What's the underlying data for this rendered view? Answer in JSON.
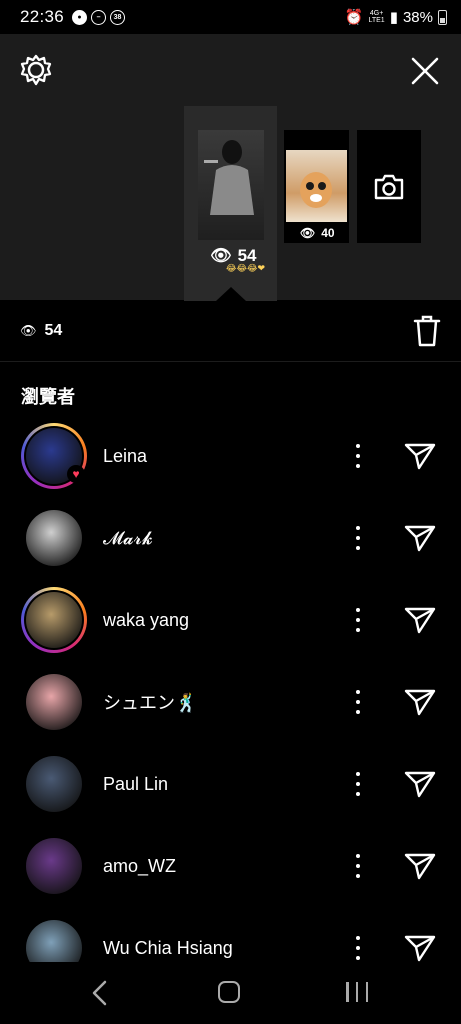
{
  "status_bar": {
    "time": "22:36",
    "notif_badge": "38",
    "network": "4G+",
    "network_sub": "LTE1",
    "battery": "38%"
  },
  "story": {
    "selected_views": "54",
    "second_views": "40",
    "emojis": "😂😂😂❤"
  },
  "stats": {
    "views": "54"
  },
  "viewers_title": "瀏覽者",
  "viewers": [
    {
      "name": "Leina",
      "ring": true,
      "liked": true,
      "avatar_color": "#2b3a8f"
    },
    {
      "name": "𝓜𝓪𝓻𝓴",
      "ring": false,
      "liked": false,
      "avatar_color": "#cfcfcf"
    },
    {
      "name": "waka yang",
      "ring": true,
      "liked": false,
      "avatar_color": "#b79b6a"
    },
    {
      "name": "シュエン🕺",
      "ring": false,
      "liked": false,
      "avatar_color": "#e7a5a8"
    },
    {
      "name": "Paul Lin",
      "ring": false,
      "liked": false,
      "avatar_color": "#4a5a74"
    },
    {
      "name": "amo_WZ",
      "ring": false,
      "liked": false,
      "avatar_color": "#6a3a8a"
    },
    {
      "name": "Wu Chia Hsiang",
      "ring": false,
      "liked": false,
      "avatar_color": "#7fa0b8"
    }
  ],
  "colors": {
    "panel": "#1c1c1c",
    "background": "#000000",
    "heart": "#ff3b5c"
  }
}
